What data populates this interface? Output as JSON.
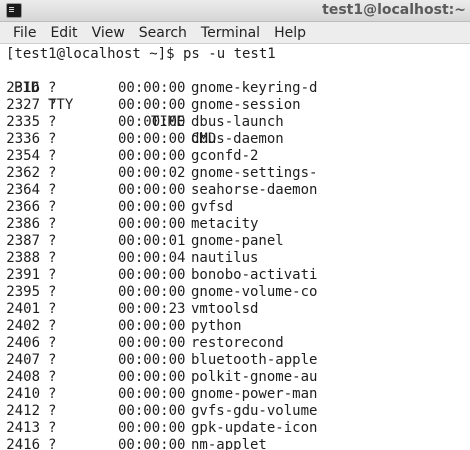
{
  "window": {
    "title": "test1@localhost:~"
  },
  "menu": {
    "items": [
      "File",
      "Edit",
      "View",
      "Search",
      "Terminal",
      "Help"
    ]
  },
  "terminal": {
    "prompt_line": "[test1@localhost ~]$ ps -u test1",
    "headers": {
      "pid": "PID",
      "tty": "TTY",
      "time": "TIME",
      "cmd": "CMD"
    },
    "rows": [
      {
        "pid": "2316",
        "tty": "?",
        "time": "00:00:00",
        "cmd": "gnome-keyring-d"
      },
      {
        "pid": "2327",
        "tty": "?",
        "time": "00:00:00",
        "cmd": "gnome-session"
      },
      {
        "pid": "2335",
        "tty": "?",
        "time": "00:00:00",
        "cmd": "dbus-launch"
      },
      {
        "pid": "2336",
        "tty": "?",
        "time": "00:00:00",
        "cmd": "dbus-daemon"
      },
      {
        "pid": "2354",
        "tty": "?",
        "time": "00:00:00",
        "cmd": "gconfd-2"
      },
      {
        "pid": "2362",
        "tty": "?",
        "time": "00:00:02",
        "cmd": "gnome-settings-"
      },
      {
        "pid": "2364",
        "tty": "?",
        "time": "00:00:00",
        "cmd": "seahorse-daemon"
      },
      {
        "pid": "2366",
        "tty": "?",
        "time": "00:00:00",
        "cmd": "gvfsd"
      },
      {
        "pid": "2386",
        "tty": "?",
        "time": "00:00:00",
        "cmd": "metacity"
      },
      {
        "pid": "2387",
        "tty": "?",
        "time": "00:00:01",
        "cmd": "gnome-panel"
      },
      {
        "pid": "2388",
        "tty": "?",
        "time": "00:00:04",
        "cmd": "nautilus"
      },
      {
        "pid": "2391",
        "tty": "?",
        "time": "00:00:00",
        "cmd": "bonobo-activati"
      },
      {
        "pid": "2395",
        "tty": "?",
        "time": "00:00:00",
        "cmd": "gnome-volume-co"
      },
      {
        "pid": "2401",
        "tty": "?",
        "time": "00:00:23",
        "cmd": "vmtoolsd"
      },
      {
        "pid": "2402",
        "tty": "?",
        "time": "00:00:00",
        "cmd": "python"
      },
      {
        "pid": "2406",
        "tty": "?",
        "time": "00:00:00",
        "cmd": "restorecond"
      },
      {
        "pid": "2407",
        "tty": "?",
        "time": "00:00:00",
        "cmd": "bluetooth-apple"
      },
      {
        "pid": "2408",
        "tty": "?",
        "time": "00:00:00",
        "cmd": "polkit-gnome-au"
      },
      {
        "pid": "2410",
        "tty": "?",
        "time": "00:00:00",
        "cmd": "gnome-power-man"
      },
      {
        "pid": "2412",
        "tty": "?",
        "time": "00:00:00",
        "cmd": "gvfs-gdu-volume"
      },
      {
        "pid": "2413",
        "tty": "?",
        "time": "00:00:00",
        "cmd": "gpk-update-icon"
      },
      {
        "pid": "2416",
        "tty": "?",
        "time": "00:00:00",
        "cmd": "nm-applet"
      }
    ]
  }
}
